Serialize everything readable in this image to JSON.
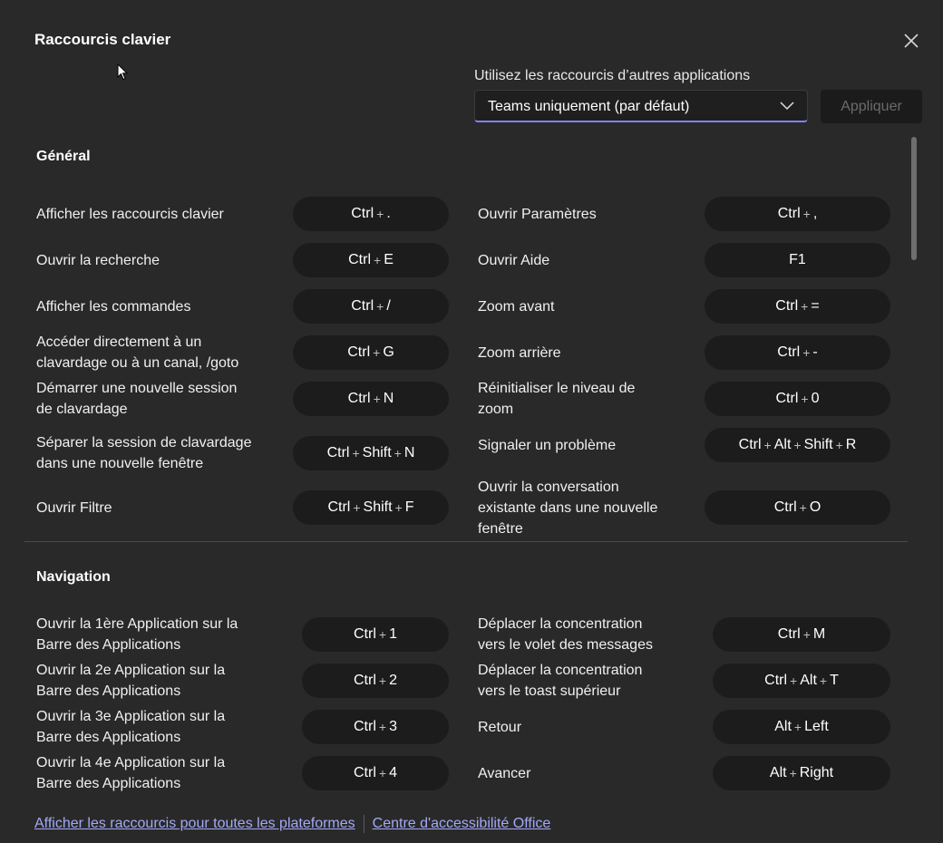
{
  "dialog": {
    "title": "Raccourcis clavier",
    "other_apps_label": "Utilisez les raccourcis d’autres applications",
    "select_value": "Teams uniquement (par défaut)",
    "apply_label": "Appliquer"
  },
  "general": {
    "title": "Général",
    "left": [
      {
        "label": "Afficher les raccourcis clavier",
        "keys": [
          "Ctrl",
          "."
        ]
      },
      {
        "label": "Ouvrir la recherche",
        "keys": [
          "Ctrl",
          "E"
        ]
      },
      {
        "label": "Afficher les commandes",
        "keys": [
          "Ctrl",
          "/"
        ]
      },
      {
        "label": "Accéder directement à un clavardage ou à un canal, /goto",
        "keys": [
          "Ctrl",
          "G"
        ]
      },
      {
        "label": "Démarrer une nouvelle session de clavardage",
        "keys": [
          "Ctrl",
          "N"
        ]
      },
      {
        "label": "Séparer la session de clavardage dans une nouvelle fenêtre",
        "keys": [
          "Ctrl",
          "Shift",
          "N"
        ]
      },
      {
        "label": "Ouvrir Filtre",
        "keys": [
          "Ctrl",
          "Shift",
          "F"
        ]
      }
    ],
    "right": [
      {
        "label": "Ouvrir Paramètres",
        "keys": [
          "Ctrl",
          ","
        ]
      },
      {
        "label": "Ouvrir Aide",
        "keys": [
          "F1"
        ]
      },
      {
        "label": "Zoom avant",
        "keys": [
          "Ctrl",
          "="
        ]
      },
      {
        "label": "Zoom arrière",
        "keys": [
          "Ctrl",
          "-"
        ]
      },
      {
        "label": "Réinitialiser le niveau de zoom",
        "keys": [
          "Ctrl",
          "0"
        ]
      },
      {
        "label": "Signaler un problème",
        "keys": [
          "Ctrl",
          "Alt",
          "Shift",
          "R"
        ]
      },
      {
        "label": "Ouvrir la conversation existante dans une nouvelle fenêtre",
        "keys": [
          "Ctrl",
          "O"
        ]
      }
    ]
  },
  "navigation": {
    "title": "Navigation",
    "left": [
      {
        "label": "Ouvrir la 1ère Application sur la Barre des Applications",
        "keys": [
          "Ctrl",
          "1"
        ]
      },
      {
        "label": "Ouvrir la 2e Application sur la Barre des Applications",
        "keys": [
          "Ctrl",
          "2"
        ]
      },
      {
        "label": "Ouvrir la 3e Application sur la Barre des Applications",
        "keys": [
          "Ctrl",
          "3"
        ]
      },
      {
        "label": "Ouvrir la 4e Application sur la Barre des Applications",
        "keys": [
          "Ctrl",
          "4"
        ]
      }
    ],
    "right": [
      {
        "label": "Déplacer la concentration vers le volet des messages",
        "keys": [
          "Ctrl",
          "M"
        ]
      },
      {
        "label": "Déplacer la concentration vers le toast supérieur",
        "keys": [
          "Ctrl",
          "Alt",
          "T"
        ]
      },
      {
        "label": "Retour",
        "keys": [
          "Alt",
          "Left"
        ]
      },
      {
        "label": "Avancer",
        "keys": [
          "Alt",
          "Right"
        ]
      }
    ]
  },
  "footer": {
    "link_all_platforms": "Afficher les raccourcis pour toutes les plateformes",
    "link_accessibility": "Centre d'accessibilité Office"
  },
  "colors": {
    "background": "#292929",
    "key_pill": "#1c1c1c",
    "accent": "#7f85f5",
    "link": "#a4a9f8"
  }
}
